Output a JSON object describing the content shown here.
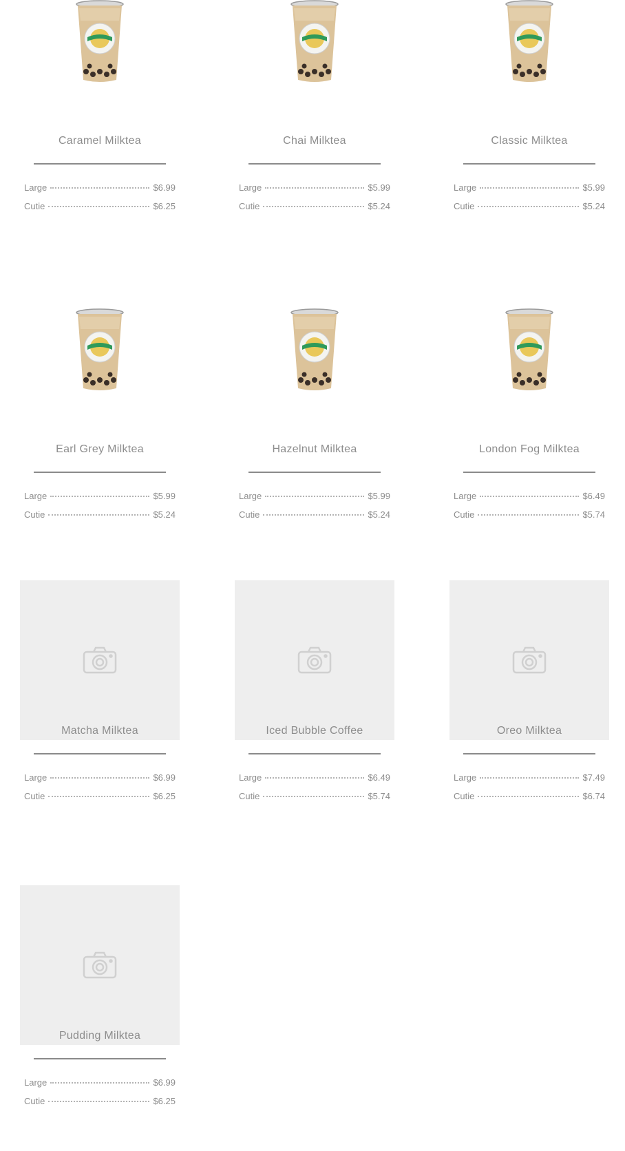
{
  "items": [
    {
      "name": "Caramel Milktea",
      "has_photo": true,
      "prices": [
        {
          "label": "Large",
          "value": "$6.99"
        },
        {
          "label": "Cutie",
          "value": "$6.25"
        }
      ]
    },
    {
      "name": "Chai Milktea",
      "has_photo": true,
      "prices": [
        {
          "label": "Large",
          "value": "$5.99"
        },
        {
          "label": "Cutie",
          "value": "$5.24"
        }
      ]
    },
    {
      "name": "Classic Milktea",
      "has_photo": true,
      "prices": [
        {
          "label": "Large",
          "value": "$5.99"
        },
        {
          "label": "Cutie",
          "value": "$5.24"
        }
      ]
    },
    {
      "name": "Earl Grey Milktea",
      "has_photo": true,
      "prices": [
        {
          "label": "Large",
          "value": "$5.99"
        },
        {
          "label": "Cutie",
          "value": "$5.24"
        }
      ]
    },
    {
      "name": "Hazelnut Milktea",
      "has_photo": true,
      "prices": [
        {
          "label": "Large",
          "value": "$5.99"
        },
        {
          "label": "Cutie",
          "value": "$5.24"
        }
      ]
    },
    {
      "name": "London Fog Milktea",
      "has_photo": true,
      "prices": [
        {
          "label": "Large",
          "value": "$6.49"
        },
        {
          "label": "Cutie",
          "value": "$5.74"
        }
      ]
    },
    {
      "name": "Matcha Milktea",
      "has_photo": false,
      "prices": [
        {
          "label": "Large",
          "value": "$6.99"
        },
        {
          "label": "Cutie",
          "value": "$6.25"
        }
      ]
    },
    {
      "name": "Iced Bubble Coffee",
      "has_photo": false,
      "prices": [
        {
          "label": "Large",
          "value": "$6.49"
        },
        {
          "label": "Cutie",
          "value": "$5.74"
        }
      ]
    },
    {
      "name": "Oreo Milktea",
      "has_photo": false,
      "prices": [
        {
          "label": "Large",
          "value": "$7.49"
        },
        {
          "label": "Cutie",
          "value": "$6.74"
        }
      ]
    },
    {
      "name": "Pudding Milktea",
      "has_photo": false,
      "prices": [
        {
          "label": "Large",
          "value": "$6.99"
        },
        {
          "label": "Cutie",
          "value": "$6.25"
        }
      ]
    }
  ],
  "icons": {
    "photo": "milk-tea-cup-image",
    "placeholder": "camera-icon"
  },
  "colors": {
    "text": "#8d8d8d",
    "rule": "#8a8a8a",
    "placeholder_bg": "#eeeeee"
  }
}
